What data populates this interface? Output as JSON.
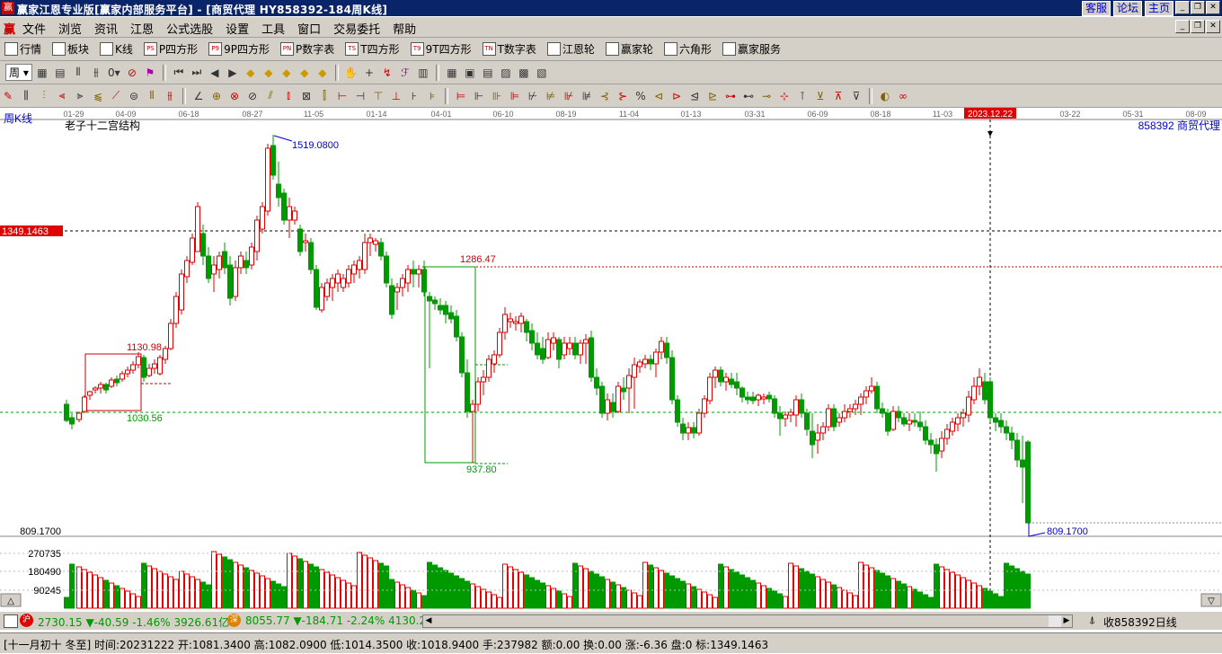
{
  "window": {
    "title": "赢家江恩专业版[赢家内部服务平台] - [商贸代理   HY858392-184周K线]",
    "links": [
      "客服",
      "论坛",
      "主页"
    ]
  },
  "menu": {
    "logo": "赢",
    "items": [
      "文件",
      "浏览",
      "资讯",
      "江恩",
      "公式选股",
      "设置",
      "工具",
      "窗口",
      "交易委托",
      "帮助"
    ]
  },
  "toolbar1": [
    {
      "label": "行情",
      "icon": "grid-icon"
    },
    {
      "label": "板块",
      "icon": "blocks-icon"
    },
    {
      "label": "K线",
      "icon": "candles-icon"
    },
    {
      "label": "P四方形",
      "icon": "ps-icon",
      "glyph": "PS"
    },
    {
      "label": "9P四方形",
      "icon": "p9-icon",
      "glyph": "P9"
    },
    {
      "label": "P数字表",
      "icon": "pn-icon",
      "glyph": "PN"
    },
    {
      "label": "T四方形",
      "icon": "ts-icon",
      "glyph": "TS"
    },
    {
      "label": "9T四方形",
      "icon": "t9-icon",
      "glyph": "T9"
    },
    {
      "label": "T数字表",
      "icon": "tn-icon",
      "glyph": "TN"
    },
    {
      "label": "江恩轮",
      "icon": "gann-wheel-icon"
    },
    {
      "label": "赢家轮",
      "icon": "winner-wheel-icon"
    },
    {
      "label": "六角形",
      "icon": "hexagon-icon"
    },
    {
      "label": "赢家服务",
      "icon": "service-icon"
    }
  ],
  "toolbar2": {
    "period": "周"
  },
  "chart": {
    "period_label": "周K线",
    "structure_title": "老子十二宫结构",
    "stock_label": "858392  商贸代理",
    "cursor_date": "2023.12.22",
    "date_ticks": [
      "01-29",
      "04-09",
      "06-18",
      "08-27",
      "11-05",
      "01-14",
      "04-01",
      "06-10",
      "08-19",
      "11-04",
      "01-13",
      "03-31",
      "06-09",
      "08-18",
      "11-03",
      "03-22",
      "05-31",
      "08-09"
    ],
    "horizontal_line_label": "1349.1463",
    "bottom_label": "809.1700",
    "annotations": {
      "high": "1519.0800",
      "level_1286": "1286.47",
      "level_1130": "1130.98",
      "level_1030": "1030.56",
      "level_937": "937.80",
      "low": "809.1700"
    },
    "volume_ticks": [
      "270735",
      "180490",
      "90245"
    ],
    "colors": {
      "up": "#e00000",
      "down": "#009900",
      "box_red": "#c00000",
      "box_green": "#00a000",
      "price_marker": "#ff0000"
    }
  },
  "status": {
    "sh_index": "2730.15",
    "sh_change": "▼-40.59",
    "sh_pct": "-1.46%",
    "sh_amount": "3926.61亿",
    "sz_index": "8055.77",
    "sz_change": "▼-184.71",
    "sz_pct": "-2.24%",
    "sz_amount": "4130.2",
    "right_label": "收858392日线"
  },
  "info": {
    "text": "[十一月初十 冬至] 时间:20231222 开:1081.3400 高:1082.0900 低:1014.3500 收:1018.9400 手:237982 额:0.00 换:0.00 涨:-6.36 盘:0 标:1349.1463"
  }
}
